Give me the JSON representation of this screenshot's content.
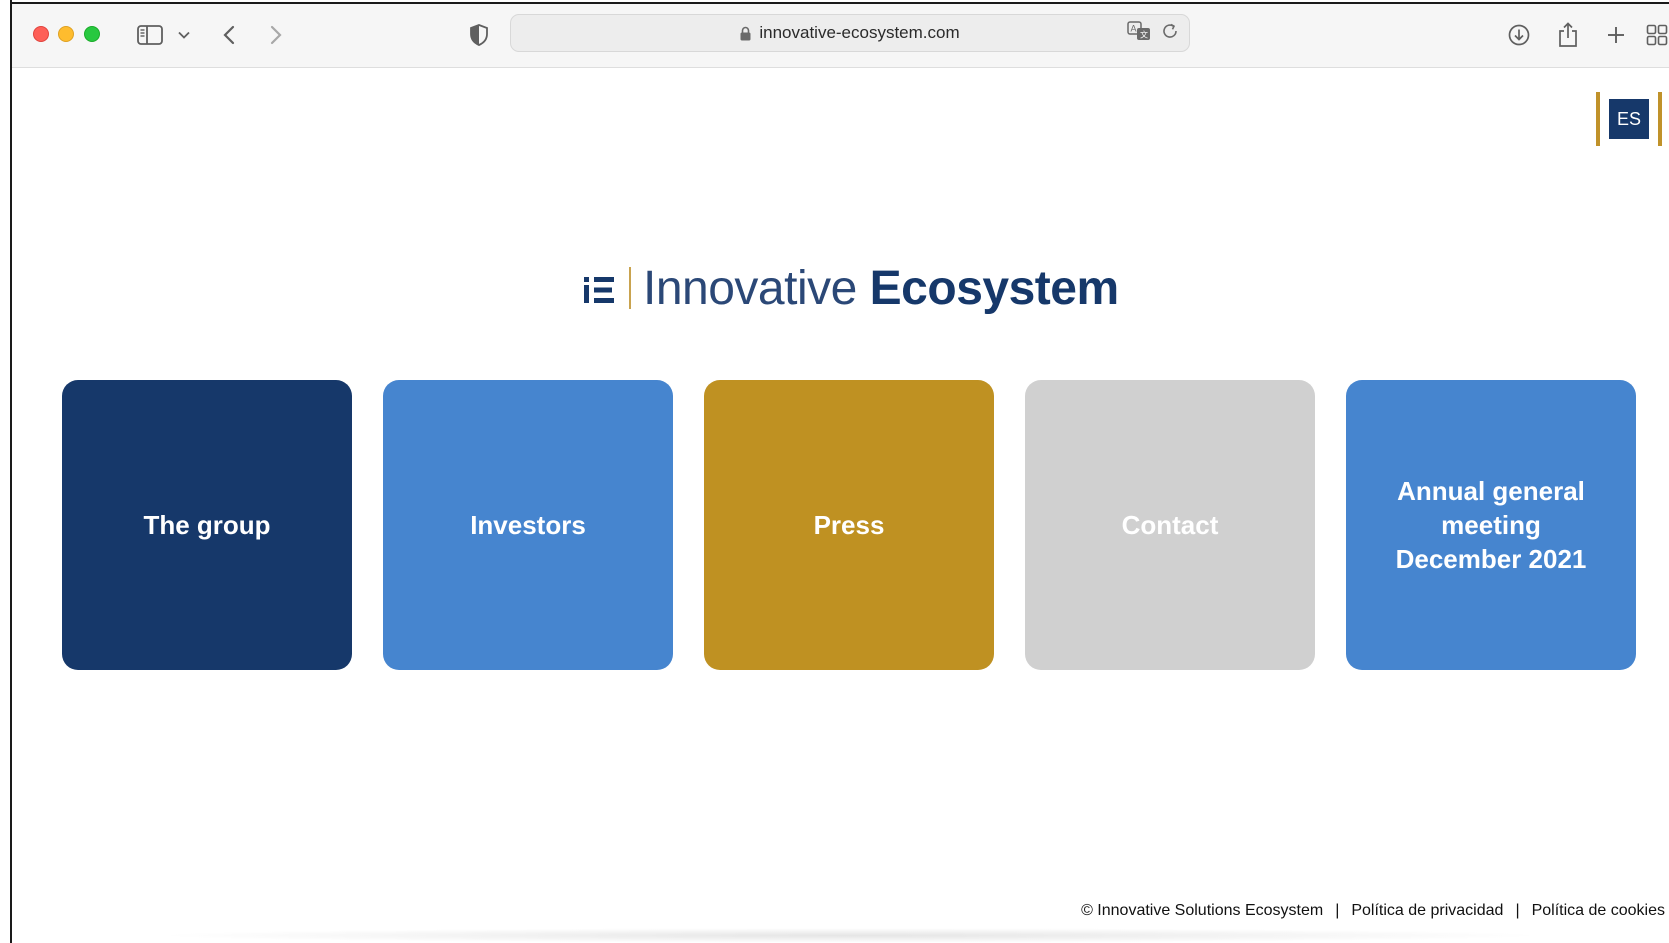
{
  "browser": {
    "url": "innovative-ecosystem.com"
  },
  "language_button": {
    "label": "ES"
  },
  "logo": {
    "mark": "iE",
    "light_text": "Innovative",
    "bold_text": "Ecosystem"
  },
  "tiles": [
    {
      "label": "The group",
      "color": "#16386a"
    },
    {
      "label": "Investors",
      "color": "#4685cf"
    },
    {
      "label": "Press",
      "color": "#bf9122"
    },
    {
      "label": "Contact",
      "color": "#d0d0d0"
    },
    {
      "label": "Annual general meeting December 2021",
      "color": "#4685cf"
    }
  ],
  "footer": {
    "copyright": "© Innovative Solutions Ecosystem",
    "separator": "|",
    "privacy": "Política de privacidad",
    "cookies": "Política de cookies"
  },
  "colors": {
    "navy": "#16386a",
    "blue": "#4685cf",
    "gold": "#bf9122",
    "grey": "#d0d0d0"
  },
  "icons": {
    "toolbar": [
      "sidebar-icon",
      "chevron-down-icon",
      "back-icon",
      "forward-icon",
      "shield-icon",
      "lock-icon",
      "translate-icon",
      "reload-icon",
      "download-icon",
      "share-icon",
      "new-tab-icon",
      "tab-overview-icon"
    ]
  }
}
